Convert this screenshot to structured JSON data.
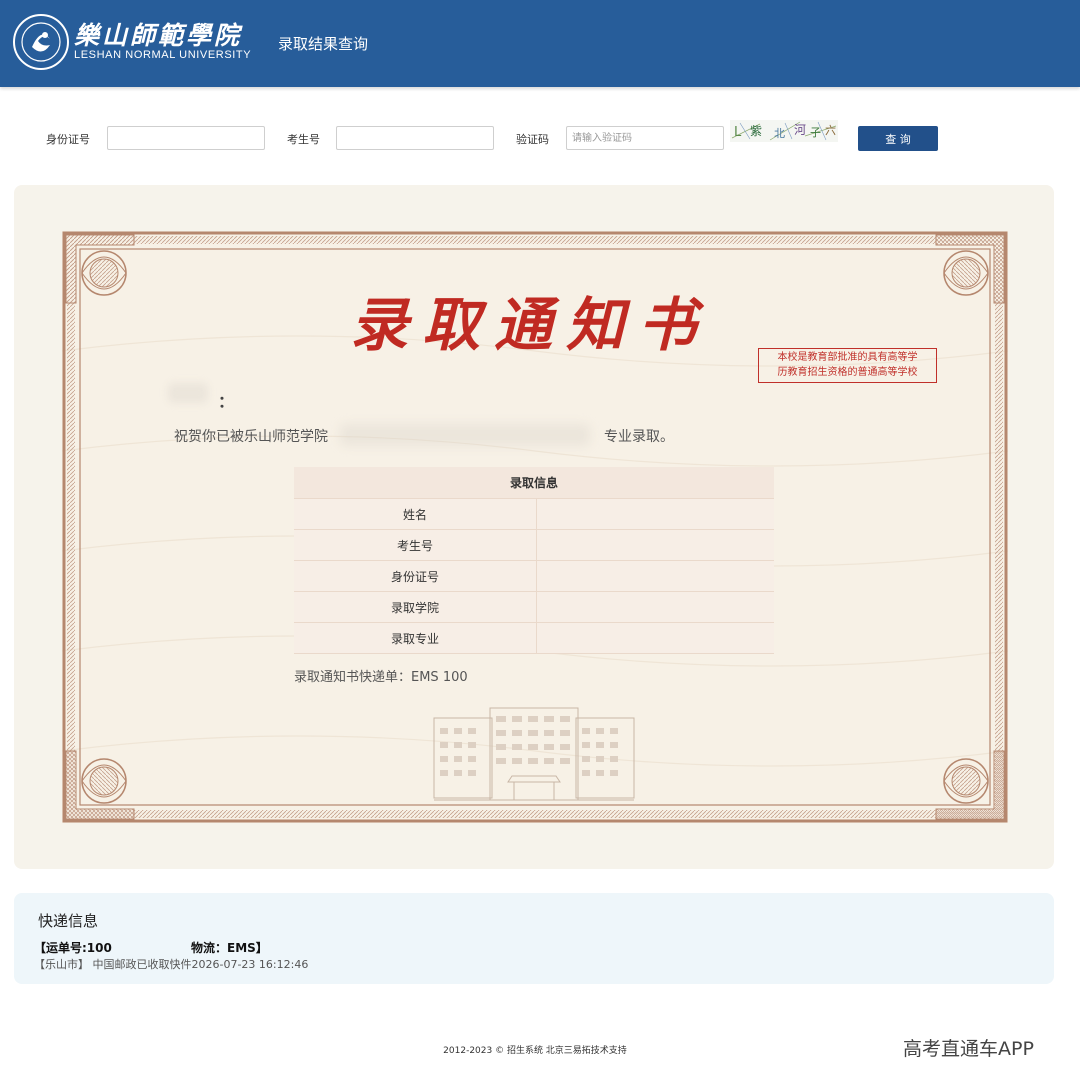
{
  "header": {
    "school_name_cn": "樂山師範學院",
    "school_name_en": "LESHAN NORMAL UNIVERSITY",
    "page_title": "录取结果查询",
    "bg_color": "#275d9a"
  },
  "query": {
    "id_label": "身份证号",
    "id_value": "",
    "exam_no_label": "考生号",
    "exam_no_value": "",
    "captcha_label": "验证码",
    "captcha_placeholder": "请输入验证码",
    "captcha_image_text": "L 紫 北 河 子 六",
    "query_button": "查 询"
  },
  "notice": {
    "title": "录取通知书",
    "stamp_line1": "本校是教育部批准的具有高等学",
    "stamp_line2": "历教育招生资格的普通高等学校",
    "colon": "：",
    "congrats_prefix": "祝贺你已被乐山师范学院",
    "congrats_suffix": "专业录取。",
    "table_title": "录取信息",
    "rows": [
      {
        "label": "姓名",
        "value": ""
      },
      {
        "label": "考生号",
        "value": ""
      },
      {
        "label": "身份证号",
        "value": ""
      },
      {
        "label": "录取学院",
        "value": ""
      },
      {
        "label": "录取专业",
        "value": ""
      }
    ],
    "express_line": "录取通知书快递单：EMS 100",
    "title_color": "#c02a22"
  },
  "delivery": {
    "title": "快递信息",
    "waybill": "【运单号:100",
    "carrier": "物流：EMS】",
    "track_line": "【乐山市】 中国邮政已收取快件2026-07-23 16:12:46"
  },
  "footer": {
    "text": "2012-2023 © 招生系统 北京三易拓技术支持"
  },
  "watermark": "高考直通车APP"
}
